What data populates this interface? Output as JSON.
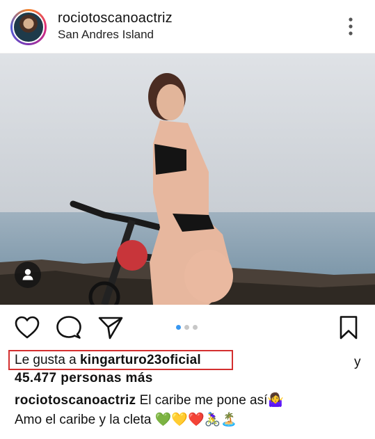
{
  "post": {
    "username": "rociotoscanoactriz",
    "location": "San Andres Island"
  },
  "icons": {
    "more": "more-vertical-icon",
    "like": "heart-icon",
    "comment": "comment-icon",
    "share": "paper-plane-icon",
    "save": "bookmark-icon",
    "tag": "person-tag-icon"
  },
  "carousel": {
    "count": 3,
    "active_index": 0
  },
  "likes": {
    "prefix": "Le gusta a ",
    "user": "kingarturo23oficial",
    "trailing": "y",
    "others": "45.477 personas más"
  },
  "caption": {
    "username": "rociotoscanoactriz",
    "line1": " El caribe me pone así🤷‍♀️",
    "line2": "Amo el caribe y la cleta 💚💛❤️🚴‍♀️🏝️"
  },
  "colors": {
    "highlight_border": "#d32f2f",
    "carousel_active": "#3897f0",
    "carousel_inactive": "#c7c7c7"
  }
}
